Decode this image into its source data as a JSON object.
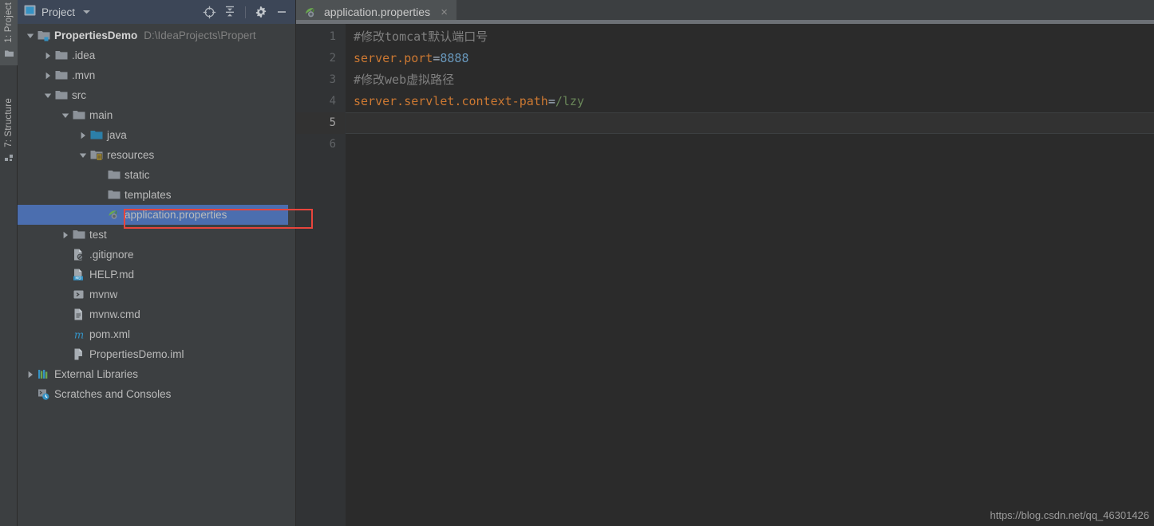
{
  "left_strip": {
    "buttons": [
      {
        "label": "1: Project",
        "icon": "project-folder-icon",
        "active": true
      },
      {
        "label": "7: Structure",
        "icon": "structure-icon",
        "active": false
      }
    ]
  },
  "project_panel": {
    "header": {
      "title": "Project",
      "view_icon": "project-view-icon",
      "dropdown_icon": "chevron-down-icon",
      "actions": [
        {
          "name": "locate-icon",
          "tooltip": "Select Opened File"
        },
        {
          "name": "collapse-all-icon",
          "tooltip": "Collapse All"
        },
        {
          "name": "gear-icon",
          "tooltip": "Settings"
        },
        {
          "name": "minimize-icon",
          "tooltip": "Hide"
        }
      ]
    },
    "tree": [
      {
        "label": "PropertiesDemo",
        "path": "D:\\IdeaProjects\\Propert",
        "icon": "module-folder-icon",
        "indent": 0,
        "arrow": "down",
        "bold": true,
        "selected": false
      },
      {
        "label": ".idea",
        "path": "",
        "icon": "folder-icon",
        "indent": 1,
        "arrow": "right",
        "bold": false,
        "selected": false
      },
      {
        "label": ".mvn",
        "path": "",
        "icon": "folder-icon",
        "indent": 1,
        "arrow": "right",
        "bold": false,
        "selected": false
      },
      {
        "label": "src",
        "path": "",
        "icon": "folder-icon",
        "indent": 1,
        "arrow": "down",
        "bold": false,
        "selected": false
      },
      {
        "label": "main",
        "path": "",
        "icon": "folder-icon",
        "indent": 2,
        "arrow": "down",
        "bold": false,
        "selected": false
      },
      {
        "label": "java",
        "path": "",
        "icon": "source-folder-icon",
        "indent": 3,
        "arrow": "right",
        "bold": false,
        "selected": false
      },
      {
        "label": "resources",
        "path": "",
        "icon": "resources-folder-icon",
        "indent": 3,
        "arrow": "down",
        "bold": false,
        "selected": false
      },
      {
        "label": "static",
        "path": "",
        "icon": "folder-icon",
        "indent": 4,
        "arrow": "none",
        "bold": false,
        "selected": false
      },
      {
        "label": "templates",
        "path": "",
        "icon": "folder-icon",
        "indent": 4,
        "arrow": "none",
        "bold": false,
        "selected": false
      },
      {
        "label": "application.properties",
        "path": "",
        "icon": "spring-properties-icon",
        "indent": 4,
        "arrow": "none",
        "bold": false,
        "selected": true
      },
      {
        "label": "test",
        "path": "",
        "icon": "folder-icon",
        "indent": 2,
        "arrow": "right",
        "bold": false,
        "selected": false
      },
      {
        "label": ".gitignore",
        "path": "",
        "icon": "gitignore-file-icon",
        "indent": 2,
        "arrow": "none",
        "bold": false,
        "selected": false
      },
      {
        "label": "HELP.md",
        "path": "",
        "icon": "markdown-file-icon",
        "indent": 2,
        "arrow": "none",
        "bold": false,
        "selected": false
      },
      {
        "label": "mvnw",
        "path": "",
        "icon": "shell-script-icon",
        "indent": 2,
        "arrow": "none",
        "bold": false,
        "selected": false
      },
      {
        "label": "mvnw.cmd",
        "path": "",
        "icon": "text-file-icon",
        "indent": 2,
        "arrow": "none",
        "bold": false,
        "selected": false
      },
      {
        "label": "pom.xml",
        "path": "",
        "icon": "maven-pom-icon",
        "indent": 2,
        "arrow": "none",
        "bold": false,
        "selected": false
      },
      {
        "label": "PropertiesDemo.iml",
        "path": "",
        "icon": "iml-module-icon",
        "indent": 2,
        "arrow": "none",
        "bold": false,
        "selected": false
      },
      {
        "label": "External Libraries",
        "path": "",
        "icon": "external-libraries-icon",
        "indent": 0,
        "arrow": "right",
        "bold": false,
        "selected": false
      },
      {
        "label": "Scratches and Consoles",
        "path": "",
        "icon": "scratches-icon",
        "indent": 0,
        "arrow": "none",
        "bold": false,
        "selected": false
      }
    ],
    "annotation": {
      "color": "#e8453c",
      "target": "application.properties"
    }
  },
  "editor": {
    "tabs": [
      {
        "label": "application.properties",
        "icon": "spring-properties-icon",
        "close_icon": "close-icon",
        "active": true
      }
    ],
    "gutter": [
      "1",
      "2",
      "3",
      "4",
      "5",
      "6"
    ],
    "current_line": 5,
    "lines": [
      {
        "num": "1",
        "tokens": [
          {
            "text": "#修改tomcat默认端口号",
            "type": "comment"
          }
        ]
      },
      {
        "num": "2",
        "tokens": [
          {
            "text": "server.port",
            "type": "key"
          },
          {
            "text": "=",
            "type": "eq"
          },
          {
            "text": "8888",
            "type": "num"
          }
        ]
      },
      {
        "num": "3",
        "tokens": [
          {
            "text": "#修改web虚拟路径",
            "type": "comment"
          }
        ]
      },
      {
        "num": "4",
        "tokens": [
          {
            "text": "server.servlet.context-path",
            "type": "key"
          },
          {
            "text": "=",
            "type": "eq"
          },
          {
            "text": "/lzy",
            "type": "val"
          }
        ]
      },
      {
        "num": "5",
        "tokens": []
      },
      {
        "num": "6",
        "tokens": []
      }
    ]
  },
  "watermark": {
    "text": "https://blog.csdn.net/qq_46301426"
  },
  "colors": {
    "panel_bg": "#3c3f41",
    "editor_bg": "#2b2b2b",
    "gutter_bg": "#313335",
    "selection_blue": "#4b6eaf",
    "header_blue": "#3c4657",
    "annotation_red": "#e8453c",
    "comment": "#808080",
    "key": "#cc7832",
    "number": "#6897bb",
    "value": "#6a8759"
  }
}
